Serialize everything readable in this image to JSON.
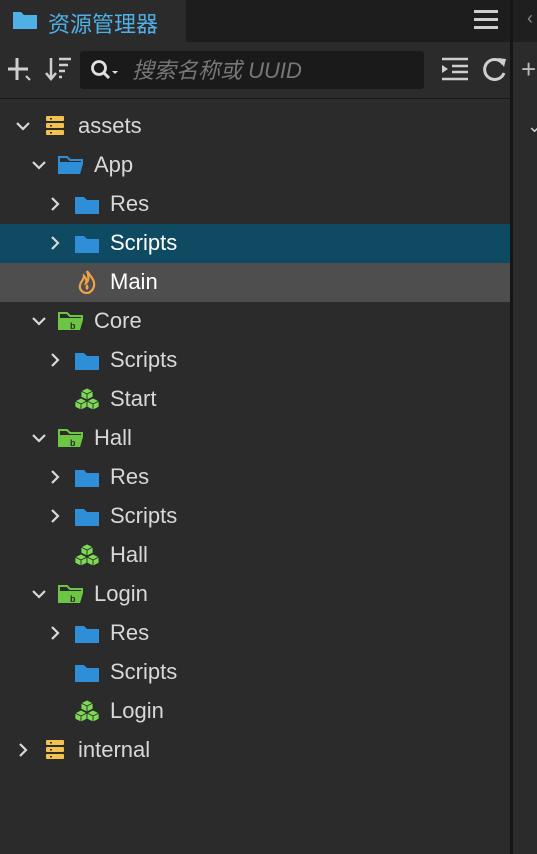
{
  "header": {
    "title": "资源管理器",
    "tab_icon": "folder-icon",
    "menu_icon": "hamburger-menu-icon"
  },
  "toolbar": {
    "add_icon": "plus-icon",
    "sort_icon": "sort-icon",
    "search_icon": "search-icon",
    "search_placeholder": "搜索名称或 UUID",
    "search_value": "",
    "collapse_icon": "collapse-all-icon",
    "refresh_icon": "refresh-icon"
  },
  "colors": {
    "accent": "#4fb0e6",
    "selected_row": "#0e4a62",
    "hover_row": "#4e4e4e",
    "db_yellow": "#f2c14e",
    "folder_blue": "#2f8ed8",
    "bundle_green": "#6cc644",
    "scene_green": "#7ed957",
    "ts_orange": "#f0a34a"
  },
  "tree": [
    {
      "label": "assets",
      "icon": "database-icon",
      "level": 0,
      "expand": "open",
      "state": "normal"
    },
    {
      "label": "App",
      "icon": "folder-open-blue-icon",
      "level": 1,
      "expand": "open",
      "state": "normal"
    },
    {
      "label": "Res",
      "icon": "folder-blue-icon",
      "level": 2,
      "expand": "closed",
      "state": "normal"
    },
    {
      "label": "Scripts",
      "icon": "folder-blue-icon",
      "level": 2,
      "expand": "closed",
      "state": "selected"
    },
    {
      "label": "Main",
      "icon": "flame-script-icon",
      "level": 2,
      "expand": "none",
      "state": "hover"
    },
    {
      "label": "Core",
      "icon": "bundle-folder-icon",
      "level": 1,
      "expand": "open",
      "state": "normal"
    },
    {
      "label": "Scripts",
      "icon": "folder-blue-icon",
      "level": 2,
      "expand": "closed",
      "state": "normal"
    },
    {
      "label": "Start",
      "icon": "scene-cubes-icon",
      "level": 2,
      "expand": "none",
      "state": "normal"
    },
    {
      "label": "Hall",
      "icon": "bundle-folder-icon",
      "level": 1,
      "expand": "open",
      "state": "normal"
    },
    {
      "label": "Res",
      "icon": "folder-blue-icon",
      "level": 2,
      "expand": "closed",
      "state": "normal"
    },
    {
      "label": "Scripts",
      "icon": "folder-blue-icon",
      "level": 2,
      "expand": "closed",
      "state": "normal"
    },
    {
      "label": "Hall",
      "icon": "scene-cubes-icon",
      "level": 2,
      "expand": "none",
      "state": "normal"
    },
    {
      "label": "Login",
      "icon": "bundle-folder-icon",
      "level": 1,
      "expand": "open",
      "state": "normal"
    },
    {
      "label": "Res",
      "icon": "folder-blue-icon",
      "level": 2,
      "expand": "closed",
      "state": "normal"
    },
    {
      "label": "Scripts",
      "icon": "folder-blue-icon",
      "level": 2,
      "expand": "none",
      "state": "normal"
    },
    {
      "label": "Login",
      "icon": "scene-cubes-icon",
      "level": 2,
      "expand": "none",
      "state": "normal"
    },
    {
      "label": "internal",
      "icon": "database-icon",
      "level": 0,
      "expand": "closed",
      "state": "normal"
    }
  ]
}
